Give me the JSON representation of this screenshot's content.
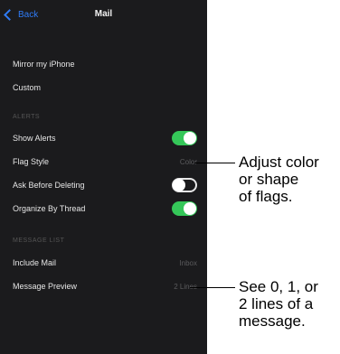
{
  "nav": {
    "back_label": "Back",
    "title": "Mail"
  },
  "rows": {
    "mirror": "Mirror my iPhone",
    "custom": "Custom"
  },
  "alerts_section": {
    "header": "Alerts"
  },
  "show_alerts": {
    "label": "Show Alerts",
    "on": true
  },
  "flag_style": {
    "label": "Flag Style",
    "value": "Color"
  },
  "ask_delete": {
    "label": "Ask Before Deleting",
    "on": false
  },
  "organize": {
    "label": "Organize By Thread",
    "on": true
  },
  "message_section": {
    "header": "Message List"
  },
  "include_mail": {
    "label": "Include Mail",
    "value": "Inbox"
  },
  "message_preview": {
    "label": "Message Preview",
    "value": "2 Lines"
  },
  "callouts": {
    "flag": [
      "Adjust color",
      "or shape",
      "of flags."
    ],
    "preview": [
      "See 0, 1, or",
      "2 lines of a",
      "message."
    ]
  },
  "colors": {
    "toggle_on": "#35c759",
    "accent": "#2f7bf6"
  }
}
